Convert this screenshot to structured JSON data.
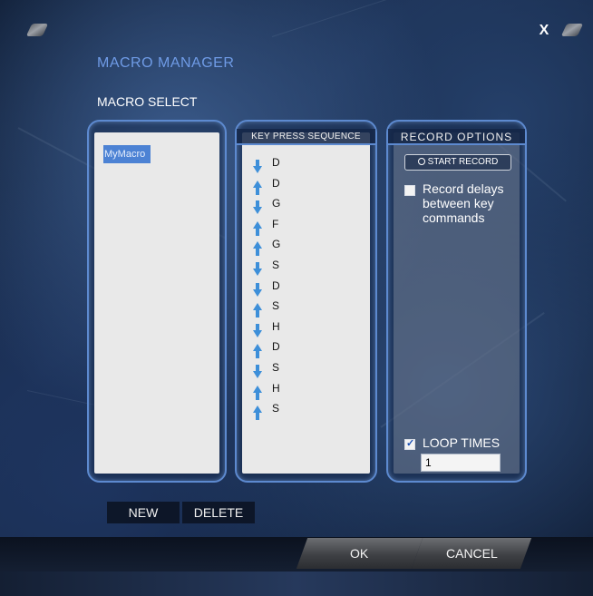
{
  "window": {
    "title": "MACRO MANAGER",
    "close_label": "X"
  },
  "macro_select": {
    "label": "MACRO SELECT",
    "items": [
      "MyMacro"
    ],
    "selected_index": 0
  },
  "key_sequence": {
    "header": "KEY PRESS SEQUENCE",
    "events": [
      {
        "dir": "down",
        "key": "D"
      },
      {
        "dir": "up",
        "key": "D"
      },
      {
        "dir": "down",
        "key": "G"
      },
      {
        "dir": "up",
        "key": "F"
      },
      {
        "dir": "up",
        "key": "G"
      },
      {
        "dir": "down",
        "key": "S"
      },
      {
        "dir": "down",
        "key": "D"
      },
      {
        "dir": "up",
        "key": "S"
      },
      {
        "dir": "down",
        "key": "H"
      },
      {
        "dir": "up",
        "key": "D"
      },
      {
        "dir": "down",
        "key": "S"
      },
      {
        "dir": "up",
        "key": "H"
      },
      {
        "dir": "up",
        "key": "S"
      }
    ]
  },
  "record_options": {
    "header": "RECORD OPTIONS",
    "start_record_label": "START RECORD",
    "record_delays": {
      "label": "Record delays between key commands",
      "checked": false
    },
    "loop_times": {
      "label": "LOOP TIMES",
      "checked": true,
      "value": "1"
    }
  },
  "buttons": {
    "new": "NEW",
    "delete": "DELETE",
    "ok": "OK",
    "cancel": "CANCEL"
  },
  "colors": {
    "accent": "#5d8ad0",
    "title": "#6f9be6",
    "arrow": "#3d8fd9",
    "selection": "#4c82d4"
  }
}
